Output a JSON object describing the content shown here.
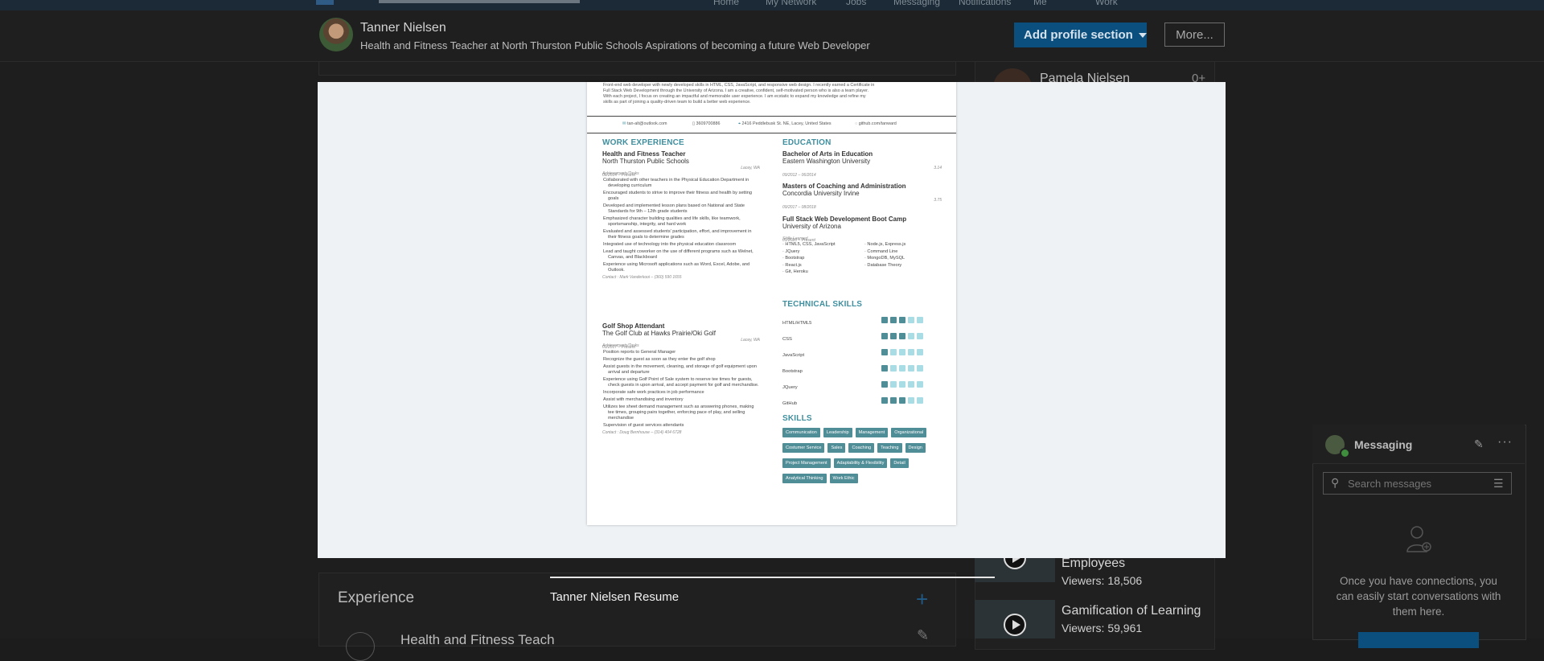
{
  "topnav": {
    "items": [
      "Home",
      "My Network",
      "Jobs",
      "Messaging",
      "Notifications",
      "Me",
      "Work"
    ]
  },
  "profile": {
    "name": "Tanner Nielsen",
    "headline": "Health and Fitness Teacher at North Thurston Public Schools Aspirations of becoming a future Web Developer",
    "add_section_label": "Add profile section",
    "more_label": "More..."
  },
  "experience": {
    "heading": "Experience",
    "first_item": "Health and Fitness Teach"
  },
  "right_rail": {
    "person_name": "Pamela Nielsen",
    "person_badge": "0+",
    "courses": [
      {
        "title": "Employees",
        "views": "Viewers: 18,506"
      },
      {
        "title": "Gamification of Learning",
        "views": "Viewers: 59,961"
      }
    ]
  },
  "messaging": {
    "title": "Messaging",
    "search_placeholder": "Search messages",
    "empty_text": "Once you have connections, you can easily start conversations with them here."
  },
  "modal": {
    "caption": "Tanner Nielsen Resume"
  },
  "resume": {
    "summary": [
      "Front-end web developer with newly developed skills in HTML, CSS, JavaScript, and responsive web design. I recently earned a Certificate in",
      "Full Stack Web Development through the University of Arizona. I am a creative, confident, self-motivated person who is also a team player.",
      "With each project, I focus on creating an impactful and memorable user experience. I am ecstatic to expand my knowledge and refine my",
      "skills as part of joining a quality-driven team to build a better web experience."
    ],
    "contact": {
      "email": "tan-alt@outlook.com",
      "phone": "3609700886",
      "address": "2416 Peddlebusk St. NE, Lacey, United States",
      "github": "github.com/tanward"
    },
    "work_heading": "WORK EXPERIENCE",
    "jobs": [
      {
        "title": "Health and Fitness Teacher",
        "company": "North Thurston Public Schools",
        "dates": "08/2014 – Present",
        "location": "Lacey, WA",
        "label": "Achievements/Tasks",
        "bullets": [
          "Collaborated with other teachers in the Physical Education Department in developing curriculum",
          "Encouraged students to strive to improve their fitness and health by setting goals",
          "Developed and implemented lesson plans based on National and State Standards for 9th – 12th grade students",
          "Emphasized character building qualities and life skills, like teamwork, sportsmanship, integrity, and hard work",
          "Evaluated and assessed students' participation, effort, and improvement in their fitness goals to determine grades",
          "Integrated use of technology into the physical education classroom",
          "Lead and taught coworker on the use of different programs such as Welnet, Canvas, and Blackboard",
          "Experience using Microsoft applications such as Word, Excel, Adobe, and Outlook."
        ],
        "contact": "Contact : Mark Vanderkooi – (360) 590 1655"
      },
      {
        "title": "Golf Shop Attendant",
        "company": "The Golf Club at Hawks Prairie/Oki Golf",
        "dates": "03/2017 – Present",
        "location": "Lacey, WA",
        "label": "Achievements/Tasks",
        "bullets": [
          "Position reports to General Manager",
          "Recognize the guest as soon as they enter the golf shop",
          "Assist guests in the movement, cleaning, and storage of golf equipment upon arrival and departure",
          "Experience using Golf Point of Sale system to reserve tee times for guests, check guests in upon arrival, and accept payment for golf and merchandise.",
          "Incorporate safe work practices in job performance",
          "Assist with merchandising and inventory",
          "Utilizes tee sheet demand management such as answering phones, making tee times, grouping pairs together, enforcing pace of play, and selling merchandise",
          "Supervision of guest services attendants"
        ],
        "contact": "Contact : Doug Bernhouse – (314) 404 6728"
      }
    ],
    "edu_heading": "EDUCATION",
    "education": [
      {
        "degree": "Bachelor of Arts in Education",
        "school": "Eastern Washington University",
        "dates": "09/2012 – 06/2014",
        "gpa": "3.14"
      },
      {
        "degree": "Masters of Coaching and Administration",
        "school": "Concordia University Irvine",
        "dates": "09/2017 – 08/2018",
        "gpa": "3.75"
      },
      {
        "degree": "Full Stack Web Development Boot Camp",
        "school": "University of Arizona",
        "dates": "01/2020 – Present",
        "gpa": ""
      }
    ],
    "skills_learned_label": "Skills Learned",
    "skills_learned_left": [
      "HTML5, CSS, JavaScript",
      "JQuery",
      "Bootstrap",
      "React.js",
      "Git, Heroku"
    ],
    "skills_learned_right": [
      "Node.js, Express.js",
      "Command Line",
      "MongoDB, MySQL",
      "Database Theory"
    ],
    "tech_heading": "TECHNICAL SKILLS",
    "tech_skills": [
      {
        "name": "HTML/HTML5",
        "level": 3
      },
      {
        "name": "CSS",
        "level": 3
      },
      {
        "name": "JavaScript",
        "level": 1
      },
      {
        "name": "Bootstrap",
        "level": 1
      },
      {
        "name": "JQuery",
        "level": 1
      },
      {
        "name": "GitHub",
        "level": 3
      }
    ],
    "tech_max": 5,
    "skills_heading": "SKILLS",
    "skills_tags": [
      "Communication",
      "Leadership",
      "Management",
      "Organizational",
      "Costumer Service",
      "Sales",
      "Coaching",
      "Teaching",
      "Design",
      "Project Management",
      "Adaptability & Flexibility",
      "Detail",
      "Analytical Thinking",
      "Work Ethic"
    ],
    "colors": {
      "accent": "#3f8f9f",
      "dot_filled": "#4f8d97",
      "dot_empty": "#a9dde6"
    }
  }
}
